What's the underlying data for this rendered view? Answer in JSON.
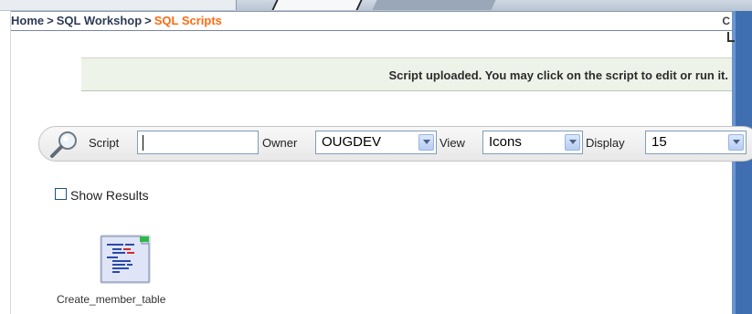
{
  "breadcrumb": {
    "items": [
      "Home",
      "SQL Workshop"
    ],
    "separator": ">",
    "current": "SQL Scripts"
  },
  "corner_letter": "C",
  "notice": {
    "message": "Script uploaded. You may click on the script to edit or run it."
  },
  "search": {
    "icon": "magnifier-icon",
    "script_label": "Script",
    "script_value": "",
    "owner_label": "Owner",
    "owner_value": "OUGDEV",
    "view_label": "View",
    "view_value": "Icons",
    "display_label": "Display",
    "display_value": "15"
  },
  "show_results": {
    "label": "Show Results",
    "checked": false
  },
  "scripts": [
    {
      "name": "Create_member_table",
      "icon": "sql-script-file-icon"
    }
  ],
  "colors": {
    "breadcrumb_current": "#ff6a13",
    "notice_background": "#eef3ea",
    "right_strip": "#3f6fb0"
  }
}
